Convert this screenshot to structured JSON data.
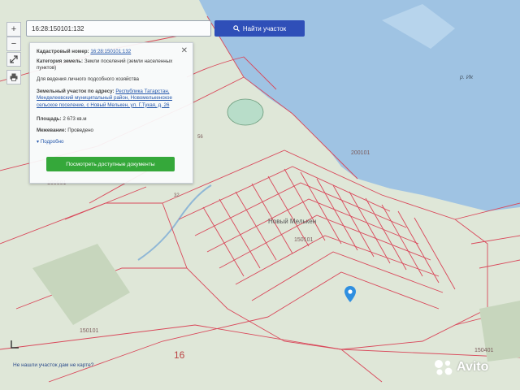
{
  "search": {
    "value": "16:28:150101:132",
    "button_label": "Найти участок"
  },
  "toolbar": {
    "zoom_in": "+",
    "zoom_out": "−"
  },
  "panel": {
    "cadastral_label": "Кадастровый номер:",
    "cadastral_value": "16:28:150101:132",
    "category_label": "Категория земель:",
    "category_value": "Земли поселений (земли населенных пунктов)",
    "use_value": "Для ведения личного подсобного хозяйства",
    "address_label": "Земельный участок по адресу:",
    "address_value": "Республика Татарстан, Менделеевский муниципальный район, Новомелькенское сельское поселение, с Новый Мелькен, ул. Г.Тукая, д. 26",
    "area_label": "Площадь:",
    "area_value": "2 673 кв.м",
    "survey_label": "Межевание:",
    "survey_value": "Проведено",
    "more_label": "Подробно",
    "docs_button": "Посмотреть доступные документы"
  },
  "map": {
    "labels": {
      "village": "Новый Мелькен",
      "river": "р. Ик",
      "block_200101": "200101",
      "block_160601": "160601",
      "block_150101": "150101",
      "block_150101_left": "150101",
      "block_150401": "150401",
      "block_16": "16",
      "block_56": "56",
      "block_32": "32"
    }
  },
  "footer": {
    "not_found_link": "Не нашли участок дам не карте?"
  },
  "watermark": {
    "brand": "Avito"
  },
  "colors": {
    "water": "#9fc3e3",
    "land": "#dfe7d8",
    "parcel_line": "#d9485a",
    "search_button": "#2f4fb8",
    "docs_button": "#35a83a",
    "pin": "#2f8fe0"
  }
}
